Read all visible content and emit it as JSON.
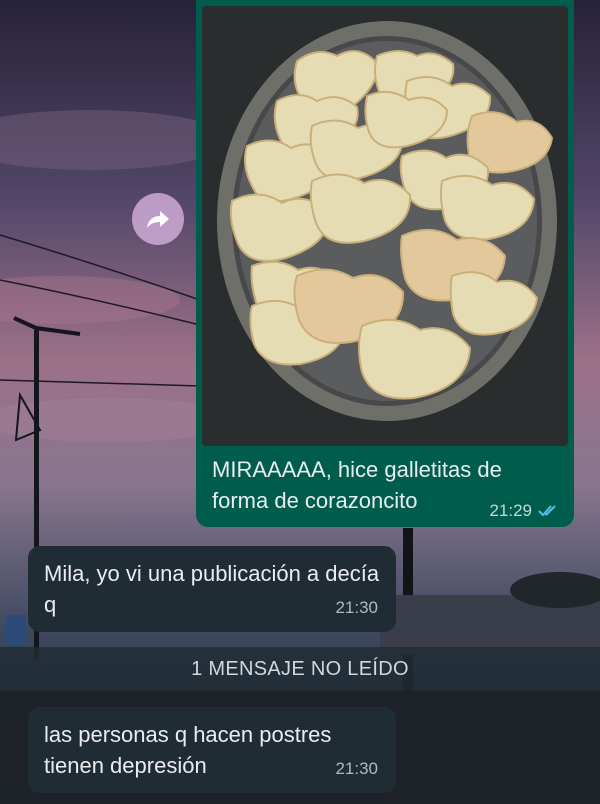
{
  "chat": {
    "forward_icon": "forward-arrow-icon",
    "outgoing": {
      "photo_icon": "heart-cookies-photo",
      "text": "MIRAAAAA, hice galletitas de forma de corazoncito",
      "time": "21:29",
      "status_icon": "double-check-icon",
      "status_color": "#53bdeb"
    },
    "incoming": [
      {
        "text": "Mila, yo vi una publicación a decía q",
        "time": "21:30"
      },
      {
        "text": "las personas q hacen postres tienen depresión",
        "time": "21:30"
      }
    ],
    "unread_banner": "1 MENSAJE NO LEÍDO"
  },
  "colors": {
    "outgoing_bubble": "#005c4b",
    "incoming_bubble": "#202c33"
  }
}
